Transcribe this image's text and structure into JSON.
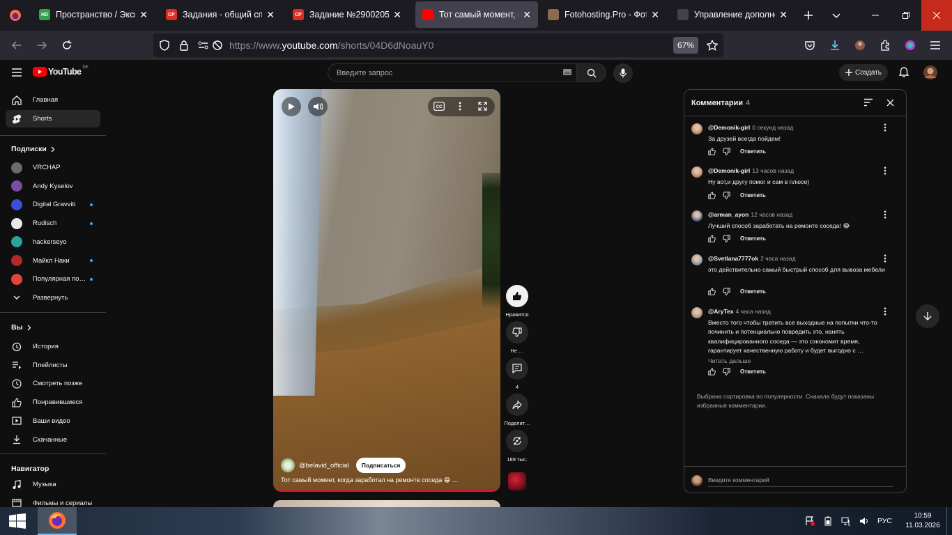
{
  "browser": {
    "tabs": [
      {
        "title": "Пространство / Экспа",
        "fav": "#2ea44f",
        "fav_text": "HD"
      },
      {
        "title": "Задания - общий спис",
        "fav": "#d93025",
        "fav_text": "CP"
      },
      {
        "title": "Задание №2900205 - пр",
        "fav": "#d93025",
        "fav_text": "CP"
      },
      {
        "title": "Тот самый момент, ко",
        "fav": "#ff0000",
        "fav_text": ""
      },
      {
        "title": "Fotohosting.Pro - Фото",
        "fav": "#8a6b50",
        "fav_text": ""
      },
      {
        "title": "Управление дополнен",
        "fav": "#42414d",
        "fav_text": ""
      }
    ],
    "url_prefix": "https://www.",
    "url_domain": "youtube.com",
    "url_path": "/shorts/04D6dNoauY0",
    "zoom": "67%"
  },
  "yt": {
    "logo_text": "YouTube",
    "region": "DE",
    "search_placeholder": "Введите запрос",
    "create_label": "Создать"
  },
  "sidebar": {
    "main": [
      {
        "label": "Главная",
        "icon": "home-icon"
      },
      {
        "label": "Shorts",
        "icon": "shorts-icon"
      }
    ],
    "subs_title": "Подписки",
    "subs": [
      {
        "label": "VRCHAP",
        "color": "#6b6b6b",
        "dot": false
      },
      {
        "label": "Andy Kyselov",
        "color": "#7a4ea3",
        "dot": false
      },
      {
        "label": "Digital Gravviti",
        "color": "#3b4fd8",
        "dot": true
      },
      {
        "label": "Rudisch",
        "color": "#e8e8e8",
        "dot": true
      },
      {
        "label": "hackerseyo",
        "color": "#2aa39b",
        "dot": false
      },
      {
        "label": "Майкл Наки",
        "color": "#b3272d",
        "dot": true
      },
      {
        "label": "Популярная по…",
        "color": "#e0453a",
        "dot": true
      }
    ],
    "expand_label": "Развернуть",
    "you_title": "Вы",
    "you": [
      {
        "label": "История",
        "icon": "history-icon"
      },
      {
        "label": "Плейлисты",
        "icon": "playlists-icon"
      },
      {
        "label": "Смотреть позже",
        "icon": "watch-later-icon"
      },
      {
        "label": "Понравившиеся",
        "icon": "liked-icon"
      },
      {
        "label": "Ваши видео",
        "icon": "your-videos-icon"
      },
      {
        "label": "Скачанные",
        "icon": "downloads-icon"
      }
    ],
    "nav_title": "Навигатор",
    "nav": [
      {
        "label": "Музыка",
        "icon": "music-icon"
      },
      {
        "label": "Фильмы и сериалы",
        "icon": "films-icon"
      }
    ]
  },
  "video": {
    "channel": "@belavid_official",
    "subscribe": "Подписаться",
    "title": "Тот самый момент, когда заработал на ремонте соседа 😁 …",
    "like_label": "Нравится",
    "dislike_label": "Не …",
    "comments_count": "4",
    "share_label": "Поделит…",
    "remix_count": "189 тыс."
  },
  "comments": {
    "title": "Комментарии",
    "count": "4",
    "reply_label": "Ответить",
    "read_more": "Читать дальше",
    "items": [
      {
        "author": "@Demonik-girl",
        "time": "0 секунд назад",
        "text": "За друзей  всегда пойдем!",
        "color": "#b07a62"
      },
      {
        "author": "@Demonik-girl",
        "time": "13 часов назад",
        "text": "Ну вот,и другу помог и сам в плюсе)",
        "color": "#b07a62"
      },
      {
        "author": "@arman_ayon",
        "time": "12 часов назад",
        "text": "Лучший способ заработать на ремонте соседа! 😂",
        "color": "#4a5a8a"
      },
      {
        "author": "@Svetlana7777ok",
        "time": "2 часа назад",
        "text": "это действительно самый быстрый способ для вывоза мебели",
        "color": "#7c8a9a"
      },
      {
        "author": "@AryTex",
        "time": "4 часа назад",
        "text": "Вместо того чтобы тратить все выходные на попытки что-то починить и потенциально повредить это, нанять квалифицированного соседа — это сэкономит время, гарантирует качественную работу и будет выгодно с …",
        "color": "#a08c78"
      }
    ],
    "sort_info": "Выбрана сортировка по популярности. Сначала будут показаны избранные комментарии.",
    "input_placeholder": "Введите комментарий"
  },
  "taskbar": {
    "lang": "РУС",
    "time": "10:59",
    "date": "11.03.2026"
  }
}
